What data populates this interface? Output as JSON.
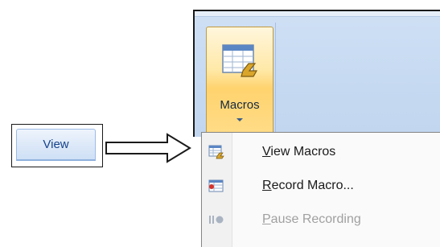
{
  "view_tab": {
    "label": "View"
  },
  "ribbon": {
    "macros_button": {
      "label": "Macros",
      "icon": "macros-icon"
    }
  },
  "menu": {
    "items": [
      {
        "label": "View Macros",
        "accel": "V",
        "rest": "iew Macros",
        "icon": "view-macros-icon",
        "enabled": true
      },
      {
        "label": "Record Macro...",
        "accel": "R",
        "rest": "ecord Macro...",
        "icon": "record-macro-icon",
        "enabled": true
      },
      {
        "label": "Pause Recording",
        "accel": "P",
        "rest": "ause Recording",
        "icon": "pause-recording-icon",
        "enabled": false
      }
    ]
  },
  "colors": {
    "tab_text": "#15428b",
    "ribbon_bg": "#c5d9f1",
    "button_highlight": "#ffd36e",
    "disabled_text": "#a0a0a0"
  }
}
